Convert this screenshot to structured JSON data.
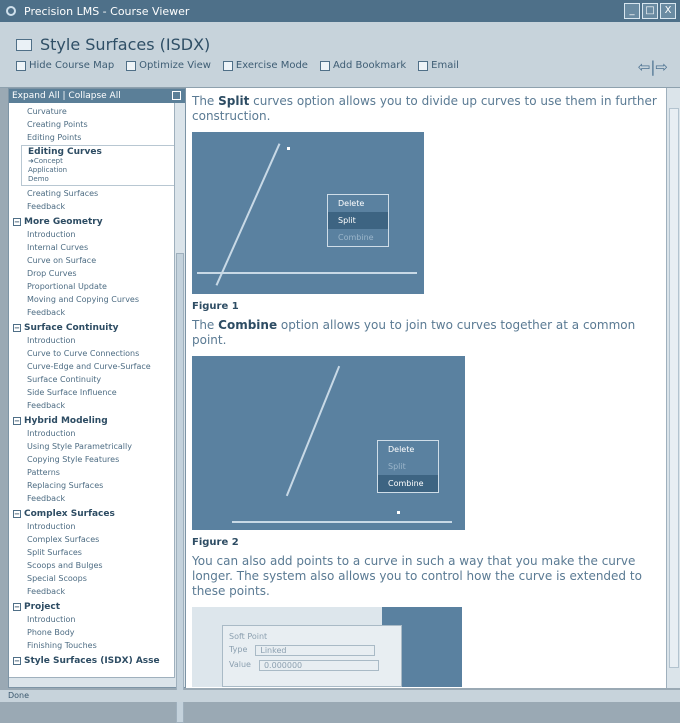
{
  "window": {
    "title": "Precision LMS - Course Viewer",
    "min": "_",
    "max": "□",
    "close": "X"
  },
  "header": {
    "course_title": "Style Surfaces (ISDX)",
    "toolbar": [
      {
        "label": "Hide Course Map",
        "icon": "checkbox-icon"
      },
      {
        "label": "Optimize View",
        "icon": "view-icon"
      },
      {
        "label": "Exercise Mode",
        "icon": "exercise-icon"
      },
      {
        "label": "Add Bookmark",
        "icon": "bookmark-icon"
      },
      {
        "label": "Email",
        "icon": "email-icon"
      }
    ],
    "nav": "⇦|⇨"
  },
  "tree": {
    "header": "Expand All | Collapse All",
    "top_items": [
      "Curvature",
      "Creating Points",
      "Editing Points"
    ],
    "selected": {
      "title": "Editing Curves",
      "subs": [
        "➜Concept",
        "Application",
        "Demo"
      ]
    },
    "top_items2": [
      "Creating Surfaces",
      "Feedback"
    ],
    "sections": [
      {
        "title": "More Geometry",
        "items": [
          "Introduction",
          "Internal Curves",
          "Curve on Surface",
          "Drop Curves",
          "Proportional Update",
          "Moving and Copying Curves",
          "Feedback"
        ]
      },
      {
        "title": "Surface Continuity",
        "items": [
          "Introduction",
          "Curve to Curve Connections",
          "Curve-Edge and Curve-Surface",
          "Surface Continuity",
          "Side Surface Influence",
          "Feedback"
        ]
      },
      {
        "title": "Hybrid Modeling",
        "items": [
          "Introduction",
          "Using Style Parametrically",
          "Copying Style Features",
          "Patterns",
          "Replacing Surfaces",
          "Feedback"
        ]
      },
      {
        "title": "Complex Surfaces",
        "items": [
          "Introduction",
          "Complex Surfaces",
          "Split Surfaces",
          "Scoops and Bulges",
          "Special Scoops",
          "Feedback"
        ]
      },
      {
        "title": "Project",
        "items": [
          "Introduction",
          "Phone Body",
          "Finishing Touches"
        ]
      },
      {
        "title": "Style Surfaces (ISDX) Asse",
        "items": []
      }
    ]
  },
  "content": {
    "p1_pre": "The ",
    "p1_bold": "Split",
    "p1_post": " curves option allows you to divide up curves to use them in further construction.",
    "fig1": {
      "menu": [
        "Delete",
        "Split",
        "Combine"
      ],
      "caption": "Figure 1"
    },
    "p2_pre": "The ",
    "p2_bold": "Combine",
    "p2_post": " option allows you to join two curves together at a common point.",
    "fig2": {
      "menu": [
        "Delete",
        "Split",
        "Combine"
      ],
      "caption": "Figure 2"
    },
    "p3": "You can also add points to a curve in such a way that you make the curve longer. The system also allows you to control how the curve is extended to these points.",
    "fig3": {
      "group": "Soft Point",
      "type_label": "Type",
      "type_value": "Linked",
      "value_label": "Value",
      "value_value": "0.000000"
    }
  },
  "status": "Done"
}
